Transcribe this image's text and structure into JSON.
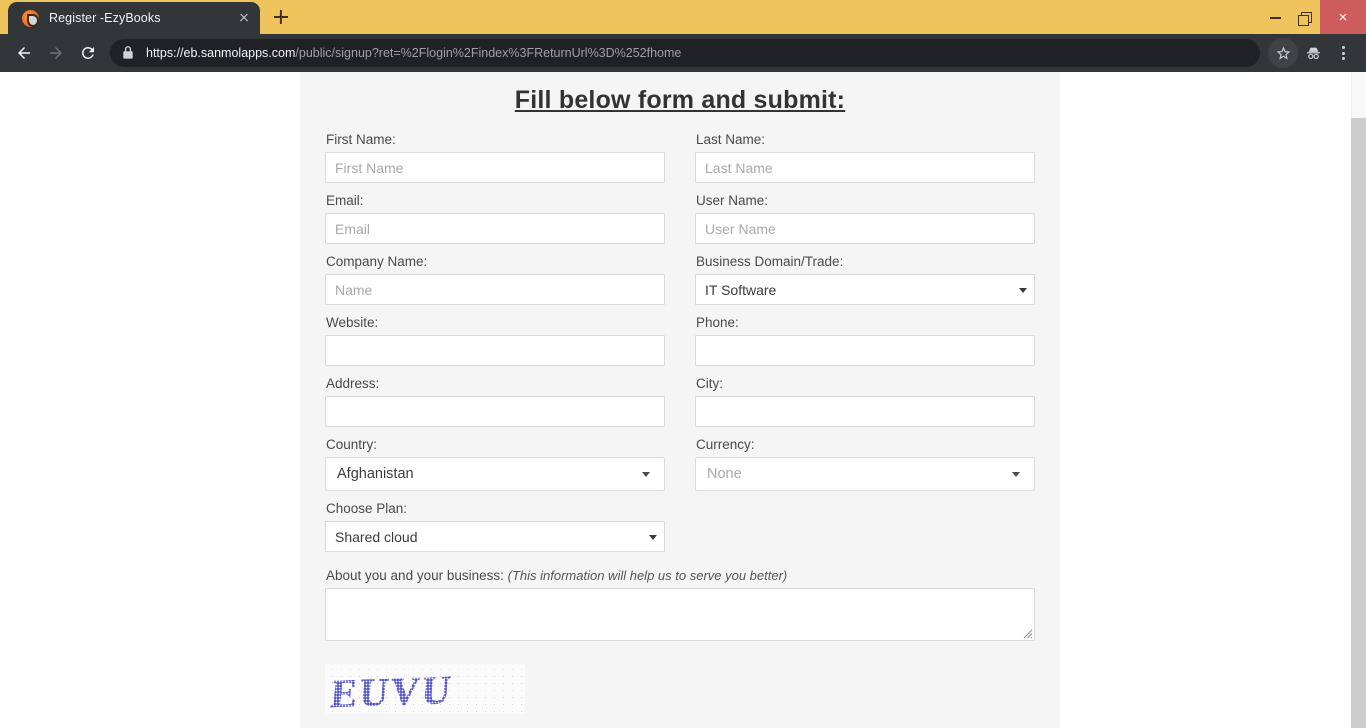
{
  "browser": {
    "tab": {
      "title": "Register -EzyBooks",
      "favicon": "ezybooks-favicon",
      "close_label": ""
    },
    "new_tab_label": "",
    "window_controls": {
      "minimize": "",
      "maximize": "",
      "close": "×"
    },
    "nav": {
      "back": "back-arrow",
      "forward": "forward-arrow",
      "reload": "reload"
    },
    "omnibox": {
      "lock": "secure-lock",
      "scheme": "https://",
      "host": "eb.sanmolapps.com",
      "path": "/public/signup?ret=%2Flogin%2Findex%3FReturnUrl%3D%252fhome",
      "full_url": "https://eb.sanmolapps.com/public/signup?ret=%2Flogin%2Findex%3FReturnUrl%3D%252fhome"
    },
    "toolbar_icons": {
      "bookmark": "star-icon",
      "incognito": "incognito-icon",
      "menu": "three-dots-icon"
    },
    "colors": {
      "titlebar": "#efc45d",
      "toolbar": "#323639",
      "omnibox": "#202124",
      "close_button": "#cd5c5c"
    }
  },
  "page": {
    "heading": "Fill below form and submit:",
    "fields": {
      "first_name": {
        "label": "First Name:",
        "placeholder": "First Name",
        "value": ""
      },
      "last_name": {
        "label": "Last Name:",
        "placeholder": "Last Name",
        "value": ""
      },
      "email": {
        "label": "Email:",
        "placeholder": "Email",
        "value": ""
      },
      "user_name": {
        "label": "User Name:",
        "placeholder": "User Name",
        "value": ""
      },
      "company_name": {
        "label": "Company Name:",
        "placeholder": "Name",
        "value": ""
      },
      "business_domain": {
        "label": "Business Domain/Trade:",
        "value": "IT Software",
        "options": [
          "IT Software"
        ]
      },
      "website": {
        "label": "Website:",
        "placeholder": "",
        "value": ""
      },
      "phone": {
        "label": "Phone:",
        "placeholder": "",
        "value": ""
      },
      "address": {
        "label": "Address:",
        "placeholder": "",
        "value": ""
      },
      "city": {
        "label": "City:",
        "placeholder": "",
        "value": ""
      },
      "country": {
        "label": "Country:",
        "value": "Afghanistan",
        "options": [
          "Afghanistan"
        ]
      },
      "currency": {
        "label": "Currency:",
        "value": "None",
        "is_placeholder": true,
        "options": [
          "None"
        ]
      },
      "choose_plan": {
        "label": "Choose Plan:",
        "value": "Shared cloud",
        "options": [
          "Shared cloud"
        ]
      },
      "about": {
        "label": "About you and your business:",
        "hint": "(This information will help us to serve you better)",
        "placeholder": "",
        "value": ""
      }
    },
    "captcha": {
      "text": "EUVU",
      "alt": "captcha-image"
    },
    "colors": {
      "panel_background": "#f5f5f5",
      "outer_background": "#ffffff",
      "input_border": "#dadada",
      "heading_color": "#333333"
    }
  }
}
